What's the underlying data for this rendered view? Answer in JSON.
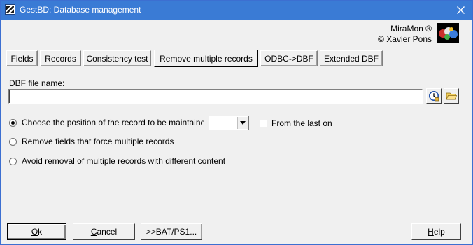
{
  "window": {
    "title": "GestBD: Database management",
    "close_glyph": "✕"
  },
  "brand": {
    "line1": "MiraMon ®",
    "line2": "© Xavier Pons",
    "logo_icon": "miramon-logo-icon"
  },
  "tabs": [
    {
      "label": "Fields"
    },
    {
      "label": "Records"
    },
    {
      "label": "Consistency test"
    },
    {
      "label": "Remove multiple records"
    },
    {
      "label": "ODBC->DBF"
    },
    {
      "label": "Extended DBF"
    }
  ],
  "active_tab": "Remove multiple records",
  "dbf": {
    "label": "DBF file name:",
    "value": ""
  },
  "options": {
    "position_label": "Choose the position of the record to be maintaine",
    "position_value": "",
    "from_last_label": "From the last on",
    "from_last_checked": false,
    "remove_fields_label": "Remove fields that force multiple records",
    "avoid_removal_label": "Avoid removal of multiple records with different content",
    "selected_option": "position"
  },
  "buttons": {
    "ok_u": "O",
    "ok_rest": "k",
    "cancel_u": "C",
    "cancel_rest": "ancel",
    "bat": ">>BAT/PS1...",
    "help_u": "H",
    "help_rest": "elp"
  },
  "colors": {
    "titlebar": "#3a7bd5",
    "window_bg": "#f0f0f0"
  }
}
